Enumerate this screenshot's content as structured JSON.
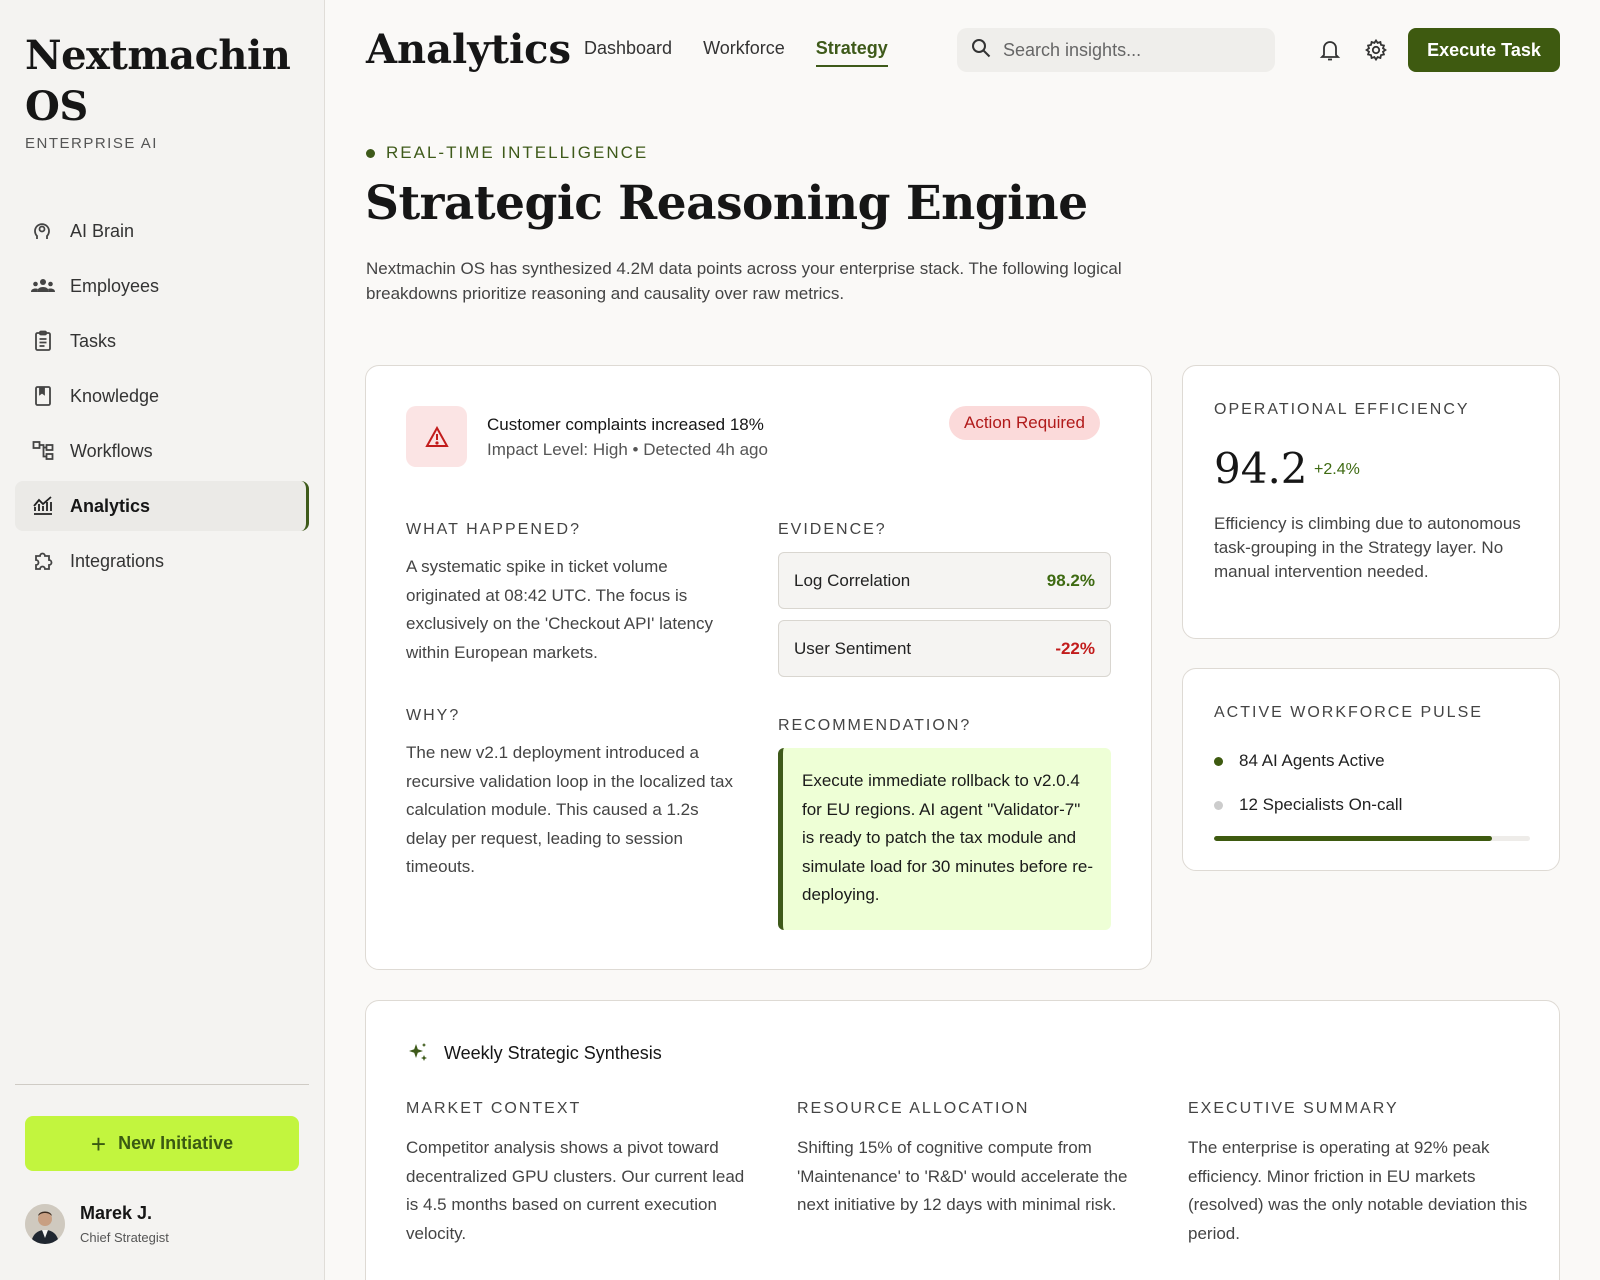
{
  "brand": {
    "name": "Nextmachin OS",
    "subtitle": "ENTERPRISE AI"
  },
  "sidebar": {
    "items": [
      {
        "label": "AI Brain",
        "icon": "brain-icon",
        "active": false
      },
      {
        "label": "Employees",
        "icon": "people-icon",
        "active": false
      },
      {
        "label": "Tasks",
        "icon": "clipboard-icon",
        "active": false
      },
      {
        "label": "Knowledge",
        "icon": "book-icon",
        "active": false
      },
      {
        "label": "Workflows",
        "icon": "workflow-icon",
        "active": false
      },
      {
        "label": "Analytics",
        "icon": "chart-icon",
        "active": true
      },
      {
        "label": "Integrations",
        "icon": "puzzle-icon",
        "active": false
      }
    ],
    "new_button": "New Initiative",
    "user": {
      "name": "Marek J.",
      "role": "Chief Strategist"
    }
  },
  "header": {
    "title": "Analytics",
    "tabs": [
      {
        "label": "Dashboard",
        "active": false
      },
      {
        "label": "Workforce",
        "active": false
      },
      {
        "label": "Strategy",
        "active": true
      }
    ],
    "search_placeholder": "Search insights...",
    "execute_button": "Execute Task"
  },
  "hero": {
    "eyebrow": "REAL-TIME INTELLIGENCE",
    "title": "Strategic Reasoning Engine",
    "intro": "Nextmachin OS has synthesized 4.2M data points across your enterprise stack. The following logical breakdowns prioritize reasoning and causality over raw metrics."
  },
  "alert": {
    "title": "Customer complaints increased 18%",
    "meta": "Impact Level: High • Detected 4h ago",
    "badge": "Action Required",
    "what_label": "WHAT HAPPENED?",
    "what_text": "A systematic spike in ticket volume originated at 08:42 UTC. The focus is exclusively on the 'Checkout API' latency within European markets.",
    "why_label": "WHY?",
    "why_text": "The new v2.1 deployment introduced a recursive validation loop in the localized tax calculation module. This caused a 1.2s delay per request, leading to session timeouts.",
    "evidence_label": "EVIDENCE?",
    "evidence": [
      {
        "label": "Log Correlation",
        "value": "98.2%"
      },
      {
        "label": "User Sentiment",
        "value": "-22%"
      }
    ],
    "recommendation_label": "RECOMMENDATION?",
    "recommendation_text": "Execute immediate rollback to v2.0.4 for EU regions. AI agent \"Validator-7\" is ready to patch the tax module and simulate load for 30 minutes before re-deploying."
  },
  "efficiency": {
    "label": "OPERATIONAL EFFICIENCY",
    "value": "94.2",
    "delta": "+2.4%",
    "text": "Efficiency is climbing due to autonomous task-grouping in the Strategy layer. No manual intervention needed."
  },
  "pulse": {
    "label": "ACTIVE WORKFORCE PULSE",
    "items": [
      "84 AI Agents Active",
      "12 Specialists On-call"
    ],
    "progress_fraction": 0.88
  },
  "synthesis": {
    "title": "Weekly Strategic Synthesis",
    "columns": [
      {
        "label": "MARKET CONTEXT",
        "text": "Competitor analysis shows a pivot toward decentralized GPU clusters. Our current lead is 4.5 months based on current execution velocity."
      },
      {
        "label": "RESOURCE ALLOCATION",
        "text": "Shifting 15% of cognitive compute from 'Maintenance' to 'R&D' would accelerate the next initiative by 12 days with minimal risk."
      },
      {
        "label": "EXECUTIVE SUMMARY",
        "text": "The enterprise is operating at 92% peak efficiency. Minor friction in EU markets (resolved) was the only notable deviation this period."
      }
    ]
  },
  "colors": {
    "accent": "#3e5a1a",
    "lime": "#c2f53e",
    "alert_red": "#c21c1c",
    "alert_bg": "#fbe4e4"
  }
}
